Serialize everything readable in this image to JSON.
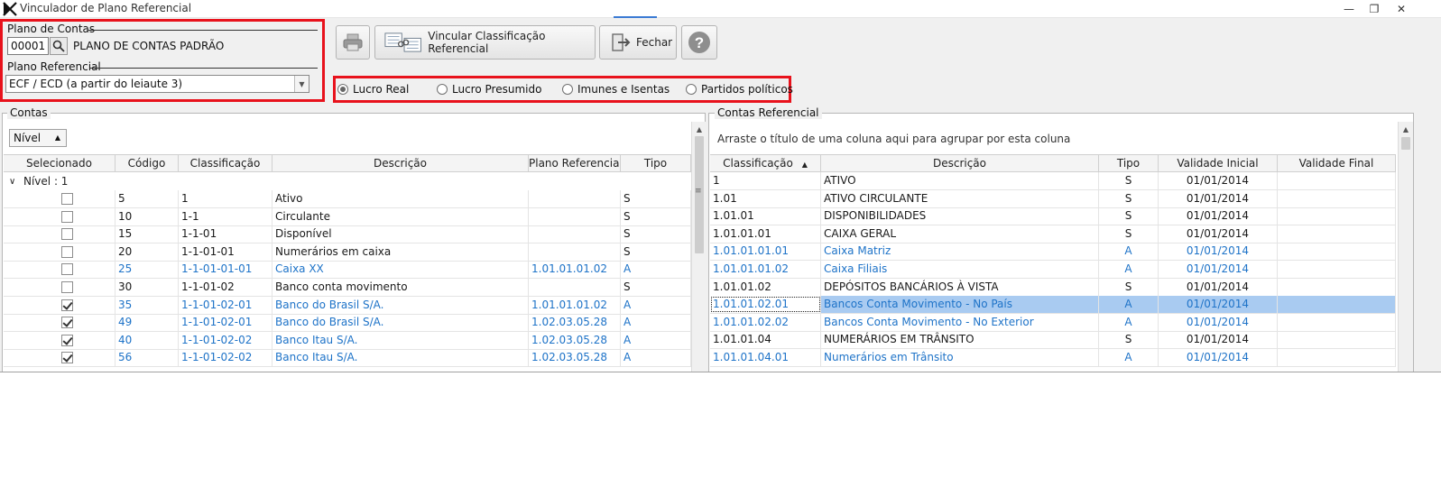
{
  "window": {
    "title": "Vinculador de Plano Referencial",
    "controls": {
      "minimize": "—",
      "restore": "❐",
      "close": "✕"
    }
  },
  "plano_contas": {
    "label": "Plano de Contas",
    "code": "00001",
    "name": "PLANO DE CONTAS PADRÃO"
  },
  "plano_referencial": {
    "label": "Plano Referencial",
    "selected": "ECF / ECD (a partir do leiaute 3)"
  },
  "toolbar": {
    "print_label": "",
    "vincular_label": "Vincular Classificação Referencial",
    "fechar_label": "Fechar",
    "help_label": "?"
  },
  "regime": {
    "options": [
      {
        "label": "Lucro Real",
        "selected": true
      },
      {
        "label": "Lucro Presumido",
        "selected": false
      },
      {
        "label": "Imunes e Isentas",
        "selected": false
      },
      {
        "label": "Partidos políticos",
        "selected": false
      }
    ]
  },
  "contas": {
    "caption": "Contas",
    "nivel_button": "Nível",
    "group_label": "Nível : 1",
    "columns": [
      "Selecionado",
      "Código",
      "Classificação",
      "Descrição",
      "Plano Referencial",
      "Tipo"
    ],
    "rows": [
      {
        "checked": false,
        "codigo": "5",
        "classificacao": "1",
        "descricao": "Ativo",
        "plano_ref": "",
        "tipo": "S",
        "linked": false
      },
      {
        "checked": false,
        "codigo": "10",
        "classificacao": "1-1",
        "descricao": "Circulante",
        "plano_ref": "",
        "tipo": "S",
        "linked": false
      },
      {
        "checked": false,
        "codigo": "15",
        "classificacao": "1-1-01",
        "descricao": "Disponível",
        "plano_ref": "",
        "tipo": "S",
        "linked": false
      },
      {
        "checked": false,
        "codigo": "20",
        "classificacao": "1-1-01-01",
        "descricao": "Numerários em caixa",
        "plano_ref": "",
        "tipo": "S",
        "linked": false
      },
      {
        "checked": false,
        "codigo": "25",
        "classificacao": "1-1-01-01-01",
        "descricao": "Caixa XX",
        "plano_ref": "1.01.01.01.02",
        "tipo": "A",
        "linked": true
      },
      {
        "checked": false,
        "codigo": "30",
        "classificacao": "1-1-01-02",
        "descricao": "Banco conta movimento",
        "plano_ref": "",
        "tipo": "S",
        "linked": false
      },
      {
        "checked": true,
        "codigo": "35",
        "classificacao": "1-1-01-02-01",
        "descricao": "Banco do Brasil S/A.",
        "plano_ref": "1.01.01.01.02",
        "tipo": "A",
        "linked": true
      },
      {
        "checked": true,
        "codigo": "49",
        "classificacao": "1-1-01-02-01",
        "descricao": "Banco do Brasil S/A.",
        "plano_ref": "1.02.03.05.28",
        "tipo": "A",
        "linked": true
      },
      {
        "checked": true,
        "codigo": "40",
        "classificacao": "1-1-01-02-02",
        "descricao": "Banco Itau S/A.",
        "plano_ref": "1.02.03.05.28",
        "tipo": "A",
        "linked": true
      },
      {
        "checked": true,
        "codigo": "56",
        "classificacao": "1-1-01-02-02",
        "descricao": "Banco Itau S/A.",
        "plano_ref": "1.02.03.05.28",
        "tipo": "A",
        "linked": true
      }
    ]
  },
  "referencial": {
    "caption": "Contas Referencial",
    "group_hint": "Arraste o título de uma coluna aqui para agrupar por esta coluna",
    "columns": [
      "Classificação",
      "Descrição",
      "Tipo",
      "Validade Inicial",
      "Validade Final"
    ],
    "rows": [
      {
        "classificacao": "1",
        "descricao": "ATIVO",
        "tipo": "S",
        "inicio": "01/01/2014",
        "fim": "",
        "analytic": false,
        "selected": false
      },
      {
        "classificacao": "1.01",
        "descricao": "ATIVO CIRCULANTE",
        "tipo": "S",
        "inicio": "01/01/2014",
        "fim": "",
        "analytic": false,
        "selected": false
      },
      {
        "classificacao": "1.01.01",
        "descricao": "DISPONIBILIDADES",
        "tipo": "S",
        "inicio": "01/01/2014",
        "fim": "",
        "analytic": false,
        "selected": false
      },
      {
        "classificacao": "1.01.01.01",
        "descricao": "CAIXA GERAL",
        "tipo": "S",
        "inicio": "01/01/2014",
        "fim": "",
        "analytic": false,
        "selected": false
      },
      {
        "classificacao": "1.01.01.01.01",
        "descricao": "Caixa Matriz",
        "tipo": "A",
        "inicio": "01/01/2014",
        "fim": "",
        "analytic": true,
        "selected": false
      },
      {
        "classificacao": "1.01.01.01.02",
        "descricao": "Caixa Filiais",
        "tipo": "A",
        "inicio": "01/01/2014",
        "fim": "",
        "analytic": true,
        "selected": false
      },
      {
        "classificacao": "1.01.01.02",
        "descricao": "DEPÓSITOS BANCÁRIOS À VISTA",
        "tipo": "S",
        "inicio": "01/01/2014",
        "fim": "",
        "analytic": false,
        "selected": false
      },
      {
        "classificacao": "1.01.01.02.01",
        "descricao": "Bancos Conta Movimento - No País",
        "tipo": "A",
        "inicio": "01/01/2014",
        "fim": "",
        "analytic": true,
        "selected": true
      },
      {
        "classificacao": "1.01.01.02.02",
        "descricao": "Bancos Conta Movimento - No Exterior",
        "tipo": "A",
        "inicio": "01/01/2014",
        "fim": "",
        "analytic": true,
        "selected": false
      },
      {
        "classificacao": "1.01.01.04",
        "descricao": "NUMERÁRIOS EM TRÂNSITO",
        "tipo": "S",
        "inicio": "01/01/2014",
        "fim": "",
        "analytic": false,
        "selected": false
      },
      {
        "classificacao": "1.01.01.04.01",
        "descricao": "Numerários em Trânsito",
        "tipo": "A",
        "inicio": "01/01/2014",
        "fim": "",
        "analytic": true,
        "selected": false
      }
    ]
  },
  "colors": {
    "highlight_red": "#e8121c",
    "link_blue": "#1e73c8",
    "selection": "#a9cbf1"
  }
}
